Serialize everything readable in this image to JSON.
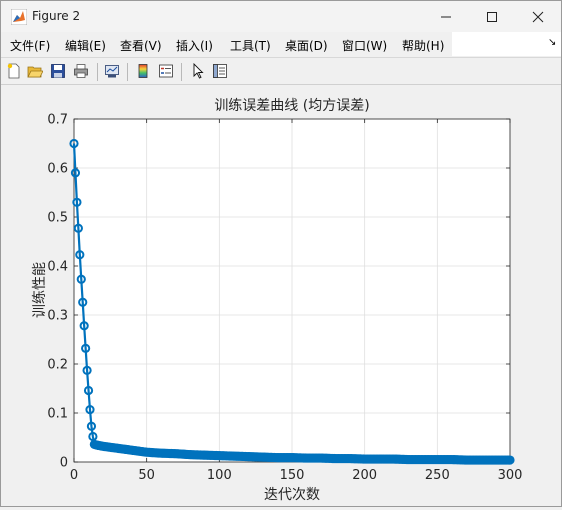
{
  "window": {
    "title": "Figure 2",
    "minimize_symbol": "—",
    "maximize_symbol": "☐",
    "close_symbol": "✕"
  },
  "menu": {
    "items": [
      "文件(F)",
      "编辑(E)",
      "查看(V)",
      "插入(I)",
      "工具(T)",
      "桌面(D)",
      "窗口(W)",
      "帮助(H)"
    ],
    "overflow_arrow": "↘"
  },
  "toolbar": {
    "icons": [
      "new-figure-icon",
      "open-file-icon",
      "save-icon",
      "print-icon",
      "link-plot-icon",
      "insert-colorbar-icon",
      "insert-legend-icon",
      "edit-plot-arrow-icon",
      "property-inspector-icon"
    ]
  },
  "chart_data": {
    "type": "line",
    "title": "训练误差曲线 (均方误差)",
    "xlabel": "迭代次数",
    "ylabel": "训练性能",
    "xlim": [
      0,
      300
    ],
    "ylim": [
      0,
      0.7
    ],
    "xticks": [
      0,
      50,
      100,
      150,
      200,
      250,
      300
    ],
    "yticks": [
      0,
      0.1,
      0.2,
      0.3,
      0.4,
      0.5,
      0.6,
      0.7
    ],
    "xtick_labels": [
      "0",
      "50",
      "100",
      "150",
      "200",
      "250",
      "300"
    ],
    "ytick_labels": [
      "0",
      "0.1",
      "0.2",
      "0.3",
      "0.4",
      "0.5",
      "0.6",
      "0.7"
    ],
    "grid": true,
    "marker": "circle",
    "color": "#0072bd",
    "series": [
      {
        "x": [
          0,
          1,
          2,
          3,
          4,
          5,
          6,
          7,
          8,
          9,
          10,
          11,
          12,
          13,
          14,
          15,
          20,
          25,
          30,
          35,
          40,
          45,
          50,
          60,
          70,
          80,
          90,
          100,
          110,
          120,
          130,
          140,
          150,
          160,
          170,
          180,
          190,
          200,
          210,
          220,
          230,
          240,
          250,
          260,
          270,
          280,
          290,
          300
        ],
        "y": [
          0.65,
          0.59,
          0.53,
          0.477,
          0.423,
          0.373,
          0.326,
          0.278,
          0.232,
          0.187,
          0.146,
          0.107,
          0.073,
          0.052,
          0.036,
          0.035,
          0.032,
          0.03,
          0.028,
          0.026,
          0.024,
          0.022,
          0.02,
          0.018,
          0.017,
          0.015,
          0.014,
          0.013,
          0.012,
          0.011,
          0.01,
          0.009,
          0.009,
          0.008,
          0.008,
          0.007,
          0.007,
          0.006,
          0.006,
          0.006,
          0.005,
          0.005,
          0.005,
          0.005,
          0.004,
          0.004,
          0.004,
          0.004
        ]
      }
    ]
  }
}
